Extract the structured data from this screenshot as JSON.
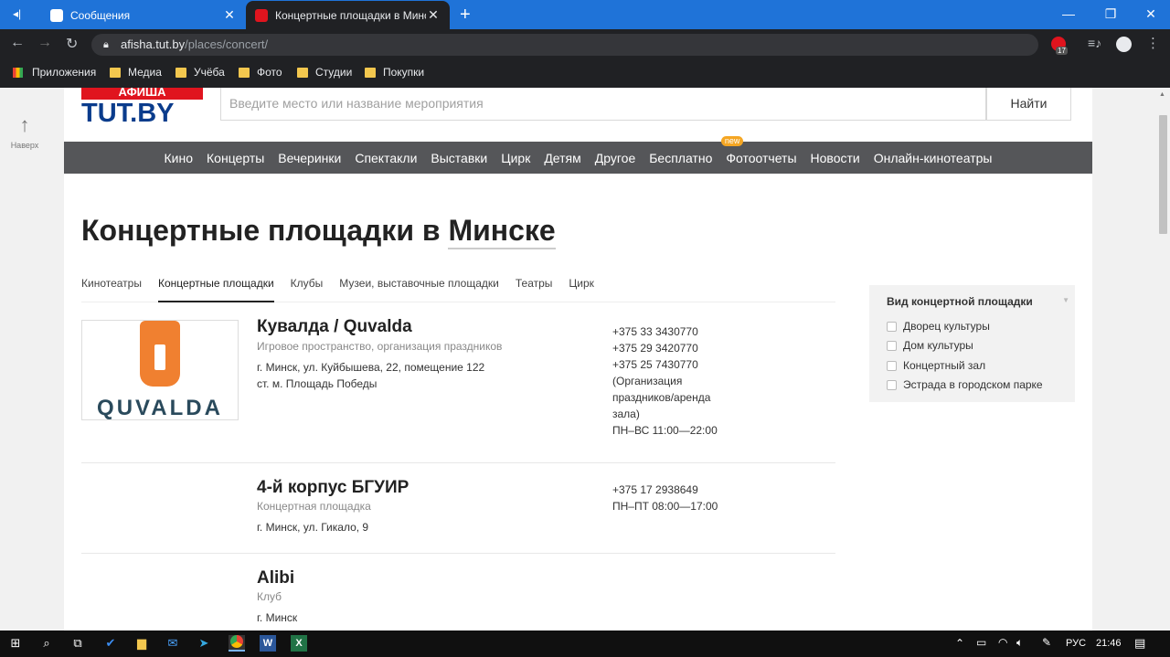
{
  "browser": {
    "tabs": [
      {
        "title": "Сообщения",
        "color": "#1f73d8"
      },
      {
        "title": "Концертные площадки в Минске",
        "color": "#e0141e"
      }
    ],
    "url_host": "afisha.tut.by",
    "url_path": "/places/concert/",
    "badge_count": "17",
    "bookmarks": [
      {
        "label": "Приложения"
      },
      {
        "label": "Медиа"
      },
      {
        "label": "Учёба"
      },
      {
        "label": "Фото"
      },
      {
        "label": "Студии"
      },
      {
        "label": "Покупки"
      }
    ]
  },
  "site": {
    "up_label": "Наверх",
    "logo_top": "АФИША",
    "logo_main": "TUT.BY",
    "search_placeholder": "Введите место или название мероприятия",
    "search_button": "Найти",
    "nav": [
      "Кино",
      "Концерты",
      "Вечеринки",
      "Спектакли",
      "Выставки",
      "Цирк",
      "Детям",
      "Другое",
      "Бесплатно",
      "Фотоотчеты",
      "Новости",
      "Онлайн-кинотеатры"
    ],
    "new_badge": "new",
    "title_prefix": "Концертные площадки в ",
    "title_city": "Минске",
    "categories": [
      "Кинотеатры",
      "Концертные площадки",
      "Клубы",
      "Музеи, выставочные площадки",
      "Театры",
      "Цирк"
    ],
    "active_category": "Концертные площадки"
  },
  "venues": [
    {
      "name": "Кувалда / Quvalda",
      "type": "Игровое пространство, организация праздников",
      "address": "г. Минск, ул. Куйбышева, 22, помещение 122",
      "metro": "ст. м. Площадь Победы",
      "logo_text": "QUVALDA",
      "phones": [
        "+375 33 3430770",
        "+375 29 3420770",
        "+375 25 7430770",
        "(Организация",
        "праздников/аренда",
        "зала)",
        "ПН–ВС 11:00—22:00"
      ]
    },
    {
      "name": "4-й корпус БГУИР",
      "type": "Концертная площадка",
      "address": "г. Минск, ул. Гикало, 9",
      "phones": [
        "+375 17 2938649",
        "ПН–ПТ 08:00—17:00"
      ]
    },
    {
      "name": "Alibi",
      "type": "Клуб",
      "address": "г. Минск",
      "phones": []
    }
  ],
  "filter": {
    "title": "Вид концертной площадки",
    "options": [
      "Дворец культуры",
      "Дом культуры",
      "Концертный зал",
      "Эстрада в городском парке"
    ]
  },
  "taskbar": {
    "lang": "РУС",
    "time": "21:46"
  }
}
